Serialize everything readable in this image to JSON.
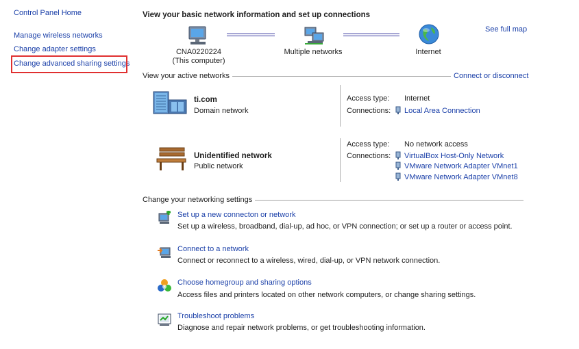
{
  "left_pane": {
    "home": "Control Panel Home",
    "links": [
      "Manage wireless networks",
      "Change adapter settings",
      "Change advanced sharing settings"
    ]
  },
  "header": {
    "title": "View your basic network information and set up connections",
    "see_full_map": "See full map"
  },
  "map": {
    "computer_name": "CNA0220224",
    "computer_sub": "(This computer)",
    "middle": "Multiple networks",
    "internet": "Internet"
  },
  "active": {
    "label": "View your active networks",
    "connect_link": "Connect or disconnect",
    "networks": [
      {
        "name": "ti.com",
        "type": "Domain network",
        "access_key": "Access type:",
        "access_val": "Internet",
        "conn_key": "Connections:",
        "connections": [
          "Local Area Connection"
        ]
      },
      {
        "name": "Unidentified network",
        "type": "Public network",
        "access_key": "Access type:",
        "access_val": "No network access",
        "conn_key": "Connections:",
        "connections": [
          "VirtualBox Host-Only Network",
          "VMware Network Adapter VMnet1",
          "VMware Network Adapter VMnet8"
        ]
      }
    ]
  },
  "settings": {
    "label": "Change your networking settings",
    "tasks": [
      {
        "title": "Set up a new connecton or network",
        "desc": "Set up a wireless, broadband, dial-up, ad hoc, or VPN connection; or set up a router or access point."
      },
      {
        "title": "Connect to a network",
        "desc": "Connect or reconnect to a wireless, wired, dial-up, or VPN network connection."
      },
      {
        "title": "Choose homegroup and sharing options",
        "desc": "Access files and printers located on other network computers, or change sharing settings."
      },
      {
        "title": "Troubleshoot problems",
        "desc": "Diagnose and repair network problems, or get troubleshooting information."
      }
    ]
  },
  "colors": {
    "link": "#1a3fa8",
    "highlight": "#e03030",
    "separator": "#a0a0a0"
  }
}
